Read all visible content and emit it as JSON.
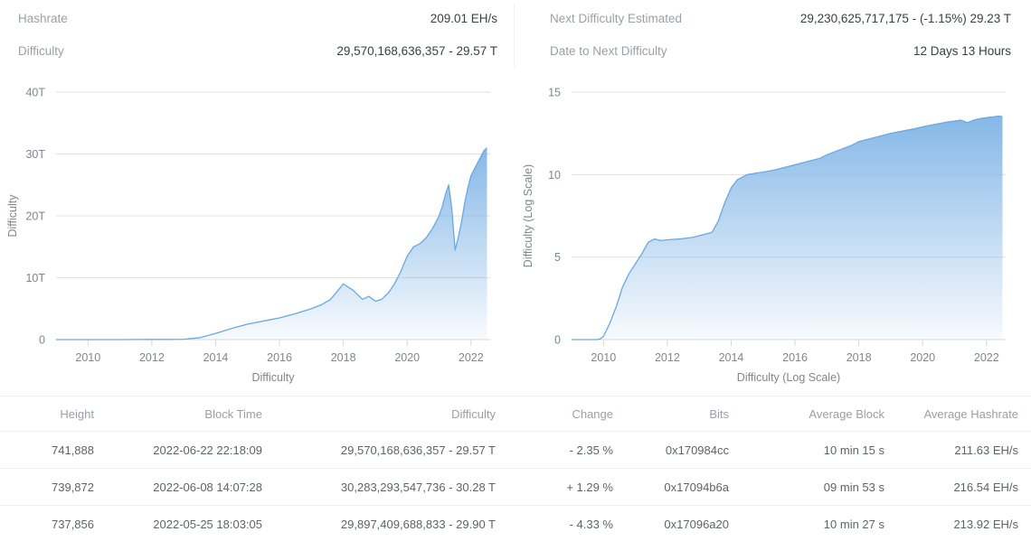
{
  "summary": {
    "left": [
      {
        "label": "Hashrate",
        "value": "209.01 EH/s"
      },
      {
        "label": "Difficulty",
        "value": "29,570,168,636,357 - 29.57 T"
      }
    ],
    "right": [
      {
        "label": "Next Difficulty Estimated",
        "value": "29,230,625,717,175 - (-1.15%) 29.23 T"
      },
      {
        "label": "Date to Next Difficulty",
        "value": "12 Days 13 Hours"
      }
    ]
  },
  "colors": {
    "line": "#6aa9e0",
    "fill_top": "#7fb4e6",
    "fill_bottom": "#ffffff",
    "grid": "#e0e0e0",
    "axis_text": "#80868b",
    "link": "#3f7fc1",
    "positive": "#2e9e4f",
    "negative": "#e53935"
  },
  "chart_data": [
    {
      "type": "area",
      "id": "difficulty-linear",
      "title": "",
      "xlabel": "Difficulty",
      "ylabel": "Difficulty",
      "xticks": [
        "2010",
        "2012",
        "2014",
        "2016",
        "2018",
        "2020",
        "2022"
      ],
      "yticks": [
        "0",
        "10T",
        "20T",
        "30T",
        "40T"
      ],
      "ylim": [
        0,
        40
      ],
      "xlim": [
        2009.0,
        2022.6
      ],
      "grid": true,
      "legend": "none",
      "units": "T",
      "x": [
        2009.0,
        2009.5,
        2010.0,
        2010.5,
        2011.0,
        2011.5,
        2012.0,
        2012.5,
        2013.0,
        2013.5,
        2014.0,
        2014.5,
        2015.0,
        2015.5,
        2016.0,
        2016.5,
        2017.0,
        2017.3,
        2017.6,
        2018.0,
        2018.3,
        2018.6,
        2018.8,
        2019.0,
        2019.2,
        2019.4,
        2019.6,
        2019.8,
        2020.0,
        2020.2,
        2020.4,
        2020.6,
        2020.8,
        2021.0,
        2021.1,
        2021.2,
        2021.3,
        2021.4,
        2021.5,
        2021.6,
        2021.7,
        2021.8,
        2021.9,
        2022.0,
        2022.1,
        2022.2,
        2022.3,
        2022.4,
        2022.5
      ],
      "values": [
        0.0,
        0.0,
        0.0,
        0.0,
        0.0,
        0.02,
        0.03,
        0.03,
        0.05,
        0.3,
        1.0,
        1.8,
        2.5,
        3.0,
        3.5,
        4.2,
        5.0,
        5.6,
        6.5,
        9.0,
        8.0,
        6.5,
        7.0,
        6.2,
        6.5,
        7.5,
        9.0,
        11.0,
        13.5,
        15.0,
        15.5,
        16.5,
        18.0,
        20.0,
        21.5,
        23.5,
        25.0,
        21.0,
        14.5,
        16.5,
        19.0,
        22.0,
        24.5,
        26.5,
        27.5,
        28.5,
        29.5,
        30.5,
        31.0
      ]
    },
    {
      "type": "area",
      "id": "difficulty-log",
      "title": "",
      "xlabel": "Difficulty (Log Scale)",
      "ylabel": "Difficulty (Log Scale)",
      "xticks": [
        "2010",
        "2012",
        "2014",
        "2016",
        "2018",
        "2020",
        "2022"
      ],
      "yticks": [
        "0",
        "5",
        "10",
        "15"
      ],
      "ylim": [
        0,
        15
      ],
      "xlim": [
        2009.0,
        2022.6
      ],
      "grid": true,
      "legend": "none",
      "x": [
        2009.0,
        2009.4,
        2009.8,
        2009.9,
        2010.0,
        2010.1,
        2010.2,
        2010.3,
        2010.4,
        2010.5,
        2010.6,
        2010.8,
        2011.0,
        2011.2,
        2011.4,
        2011.6,
        2011.8,
        2012.0,
        2012.4,
        2012.8,
        2013.0,
        2013.2,
        2013.4,
        2013.6,
        2013.8,
        2014.0,
        2014.2,
        2014.5,
        2014.8,
        2015.0,
        2015.4,
        2015.8,
        2016.0,
        2016.4,
        2016.8,
        2017.0,
        2017.4,
        2017.8,
        2018.0,
        2018.4,
        2018.8,
        2019.0,
        2019.4,
        2019.8,
        2020.0,
        2020.4,
        2020.8,
        2021.0,
        2021.2,
        2021.4,
        2021.6,
        2021.8,
        2022.0,
        2022.2,
        2022.4,
        2022.5
      ],
      "values": [
        0.0,
        0.0,
        0.0,
        0.05,
        0.2,
        0.6,
        1.0,
        1.5,
        2.0,
        2.6,
        3.2,
        4.0,
        4.6,
        5.2,
        5.9,
        6.1,
        6.0,
        6.05,
        6.1,
        6.2,
        6.3,
        6.4,
        6.5,
        7.2,
        8.3,
        9.2,
        9.7,
        10.0,
        10.1,
        10.15,
        10.3,
        10.5,
        10.6,
        10.8,
        11.0,
        11.2,
        11.5,
        11.8,
        12.0,
        12.2,
        12.4,
        12.5,
        12.65,
        12.8,
        12.9,
        13.05,
        13.2,
        13.25,
        13.3,
        13.15,
        13.3,
        13.4,
        13.45,
        13.5,
        13.55,
        13.5
      ]
    }
  ],
  "table": {
    "columns": [
      {
        "key": "height",
        "label": "Height"
      },
      {
        "key": "time",
        "label": "Block Time"
      },
      {
        "key": "diff",
        "label": "Difficulty"
      },
      {
        "key": "change",
        "label": "Change"
      },
      {
        "key": "bits",
        "label": "Bits"
      },
      {
        "key": "avgblock",
        "label": "Average Block"
      },
      {
        "key": "avghash",
        "label": "Average Hashrate"
      }
    ],
    "rows": [
      {
        "height": "741,888",
        "time": "2022-06-22 22:18:09",
        "diff": "29,570,168,636,357 - 29.57 T",
        "change": "- 2.35 %",
        "change_dir": "negative",
        "bits": "0x170984cc",
        "avgblock": "10 min 15 s",
        "avghash": "211.63 EH/s"
      },
      {
        "height": "739,872",
        "time": "2022-06-08 14:07:28",
        "diff": "30,283,293,547,736 - 30.28 T",
        "change": "+ 1.29 %",
        "change_dir": "positive",
        "bits": "0x17094b6a",
        "avgblock": "09 min 53 s",
        "avghash": "216.54 EH/s"
      },
      {
        "height": "737,856",
        "time": "2022-05-25 18:03:05",
        "diff": "29,897,409,688,833 - 29.90 T",
        "change": "- 4.33 %",
        "change_dir": "negative",
        "bits": "0x17096a20",
        "avgblock": "10 min 27 s",
        "avghash": "213.92 EH/s"
      }
    ]
  }
}
